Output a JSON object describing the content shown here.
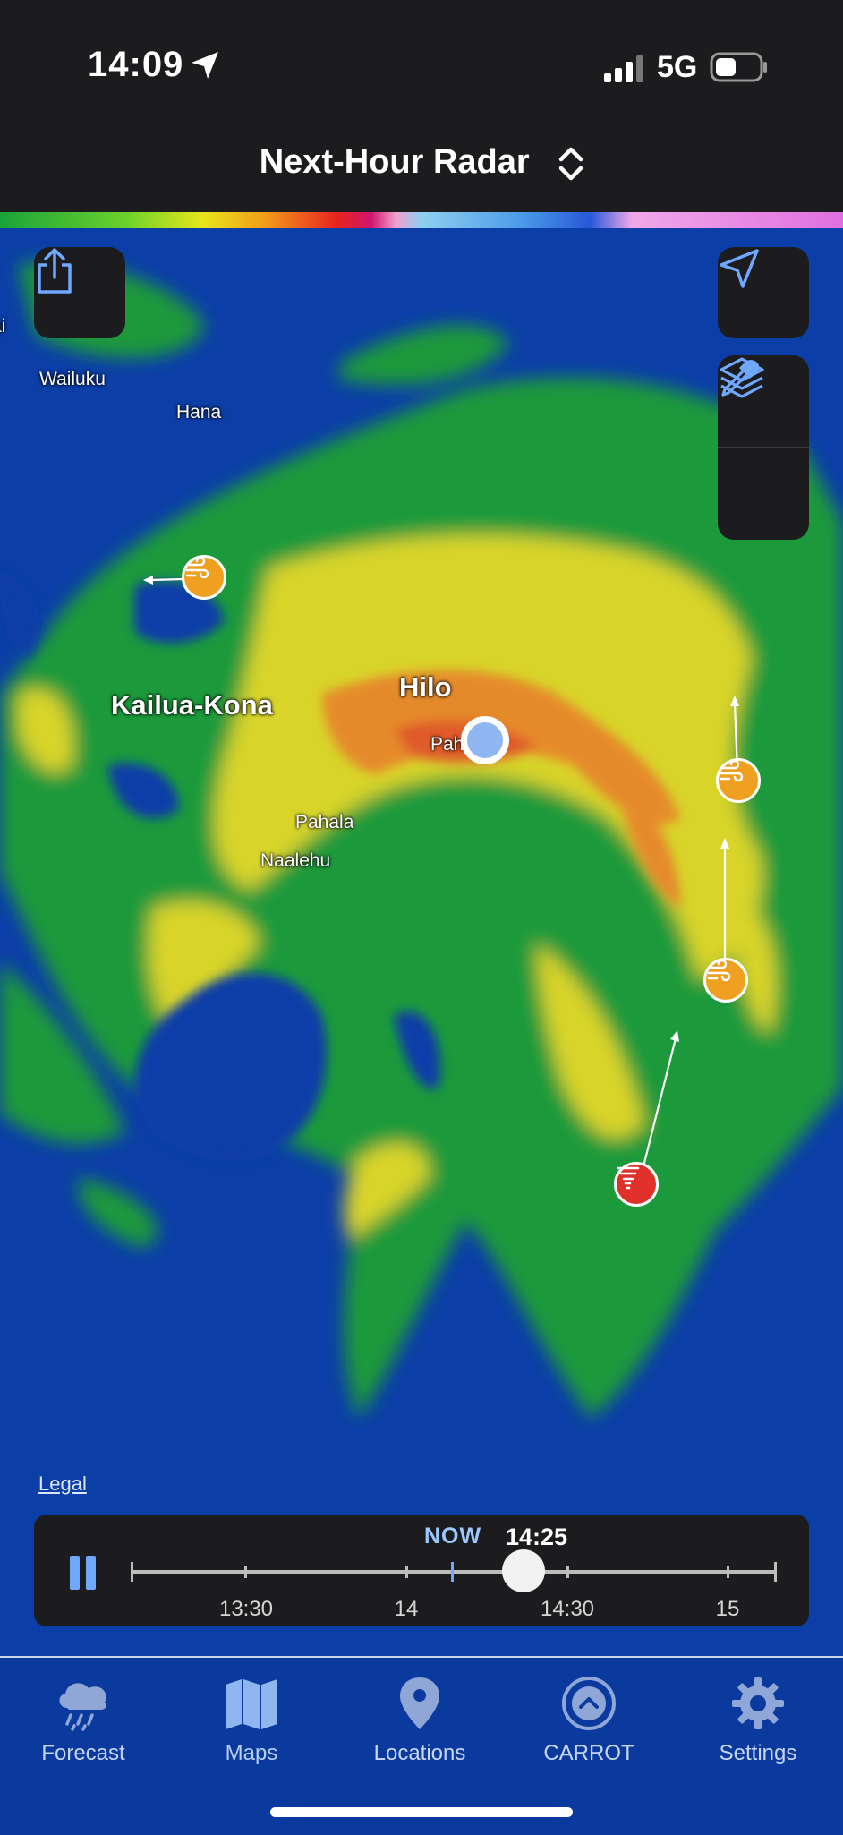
{
  "status": {
    "time": "14:09",
    "network": "5G"
  },
  "header": {
    "title": "Next-Hour Radar"
  },
  "map": {
    "places": {
      "edge": "ai",
      "wailuku": "Wailuku",
      "hana": "Hana",
      "kailua_kona": "Kailua-Kona",
      "hilo": "Hilo",
      "pahoa": "Pah",
      "pahala": "Pahala",
      "naalehu": "Naalehu"
    },
    "legal": "Legal"
  },
  "player": {
    "now_label": "NOW",
    "current_time": "14:25",
    "ticks": [
      "13:30",
      "14",
      "14:30",
      "15"
    ]
  },
  "tabs": [
    {
      "label": "Forecast",
      "icon": "cloud-rain-icon"
    },
    {
      "label": "Maps",
      "icon": "map-icon"
    },
    {
      "label": "Locations",
      "icon": "location-pin-icon"
    },
    {
      "label": "CARROT",
      "icon": "carrot-logo-icon"
    },
    {
      "label": "Settings",
      "icon": "gear-icon"
    }
  ],
  "colors": {
    "background": "#0c3ea8",
    "bar": "#1c1b1d",
    "now": "#9cc8ff",
    "storm_wind": "#f0a020",
    "storm_tornado": "#e0302a"
  }
}
